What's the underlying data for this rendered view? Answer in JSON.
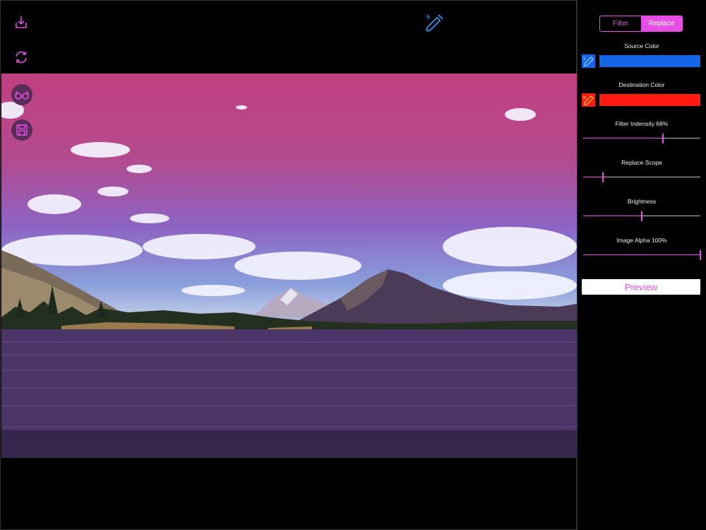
{
  "colors": {
    "accent": "#e64ee6",
    "source": "#1565e8",
    "destination": "#ff1a10",
    "eyedropper": "#2a96f0"
  },
  "toolbar": {
    "download_icon": "download-icon",
    "refresh_icon": "refresh-icon",
    "glasses_icon": "glasses-icon",
    "save_icon": "save-icon",
    "eyedropper_icon": "eyedropper-icon",
    "eyedropper_label": "S"
  },
  "panel": {
    "tabs": [
      {
        "label": "Filter",
        "active": false
      },
      {
        "label": "Replace",
        "active": true
      }
    ],
    "source_color_label": "Source Color",
    "source_picker_label": "S",
    "destination_color_label": "Destination Color",
    "destination_picker_label": "D",
    "sliders": [
      {
        "label": "Filter Indensity 68%",
        "value": 0.68
      },
      {
        "label": "Replace Scope",
        "value": 0.17
      },
      {
        "label": "Brightness",
        "value": 0.5
      },
      {
        "label": "Image Alpha 100%",
        "value": 1.0
      }
    ],
    "preview_label": "Preview"
  }
}
